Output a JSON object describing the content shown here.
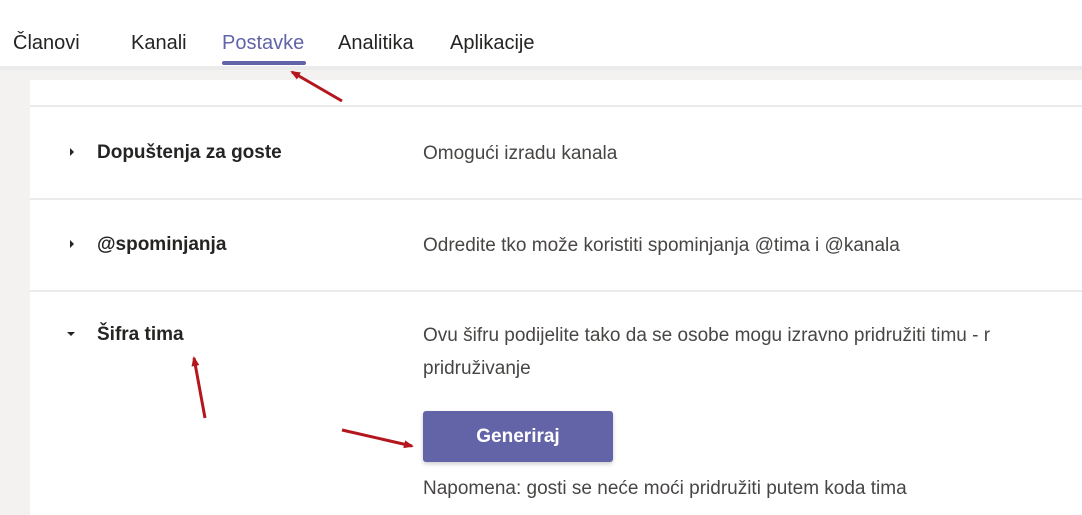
{
  "tabs": [
    {
      "label": "Članovi"
    },
    {
      "label": "Kanali"
    },
    {
      "label": "Postavke"
    },
    {
      "label": "Analitika"
    },
    {
      "label": "Aplikacije"
    }
  ],
  "settings": {
    "rows": [
      {
        "title": "Dopuštenja za goste",
        "description": "Omogući izradu kanala",
        "expanded": false
      },
      {
        "title": "@spominjanja",
        "description": "Odredite tko može koristiti spominjanja @tima i @kanala",
        "expanded": false
      },
      {
        "title": "Šifra tima",
        "description_line1": "Ovu šifru podijelite tako da se osobe mogu izravno pridružiti timu - r",
        "description_line2": "pridruživanje",
        "expanded": true
      }
    ],
    "generate_label": "Generiraj",
    "note": "Napomena: gosti se neće moći pridružiti putem koda tima"
  },
  "colors": {
    "accent": "#6264a7",
    "annotation_arrow": "#b3161c"
  },
  "icons": {
    "collapsed": "caret-right-icon",
    "expanded": "caret-down-icon",
    "annotation": "red-arrow-icon"
  }
}
